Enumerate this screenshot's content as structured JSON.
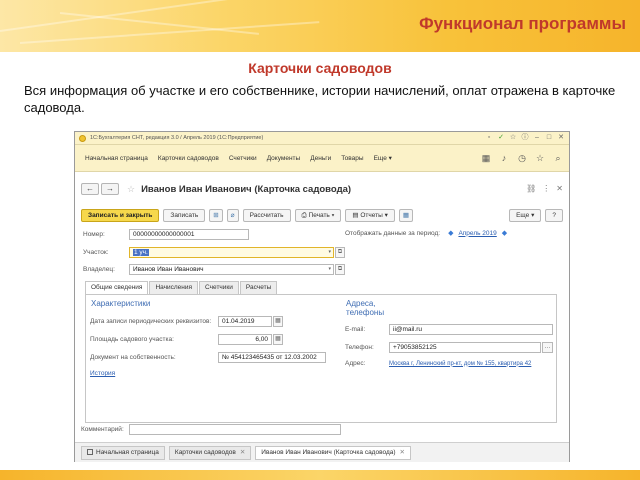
{
  "slide": {
    "title": "Функционал программы",
    "subtitle": "Карточки садоводов",
    "description": "Вся информация об участке и его собственнике, истории начислений, оплат отражена в карточке садовода."
  },
  "app": {
    "window_title": "1С:Бухгалтерия СНТ, редакция 3.0 / Апрель 2019 (1С:Предприятие)",
    "sections": [
      "Начальная страница",
      "Карточки садоводов",
      "Счетчики",
      "Документы",
      "Деньги",
      "Товары",
      "Еще"
    ],
    "more_suffix": " ▾",
    "form_title": "Иванов Иван Иванович (Карточка садовода)",
    "toolbar": {
      "save_close": "Записать и закрыть",
      "save": "Записать",
      "calculate": "Рассчитать",
      "print": "Печать",
      "reports": "Отчеты",
      "more": "Еще",
      "help": "?"
    },
    "number_label": "Номер:",
    "number_value": "00000000000000001",
    "period_label": "Отображать данные за период:",
    "period_value": "Апрель 2019",
    "plot_label": "Участок:",
    "plot_value": "1 уч.",
    "owner_label": "Владелец:",
    "owner_value": "Иванов Иван Иванович",
    "tabs": [
      "Общие сведения",
      "Начисления",
      "Счетчики",
      "Расчеты"
    ],
    "characteristics": {
      "title": "Характеристики",
      "date_label": "Дата записи периодических реквизитов:",
      "date_value": "01.04.2019",
      "area_label": "Площадь садового участка:",
      "area_value": "6,00",
      "doc_label": "Документ на собственность:",
      "doc_value": "№ 454123465435 от 12.03.2002",
      "history_link": "История"
    },
    "contacts": {
      "title_line1": "Адреса,",
      "title_line2": "телефоны",
      "email_label": "E-mail:",
      "email_value": "ii@mail.ru",
      "phone_label": "Телефон:",
      "phone_value": "+79053852125",
      "address_label": "Адрес:",
      "address_value": "Москва г, Ленинский пр-кт, дом № 155, квартира 42"
    },
    "comment_label": "Комментарий:",
    "bottom_tabs": [
      "Начальная страница",
      "Карточки садоводов",
      "Иванов Иван Иванович (Карточка садовода)"
    ]
  }
}
